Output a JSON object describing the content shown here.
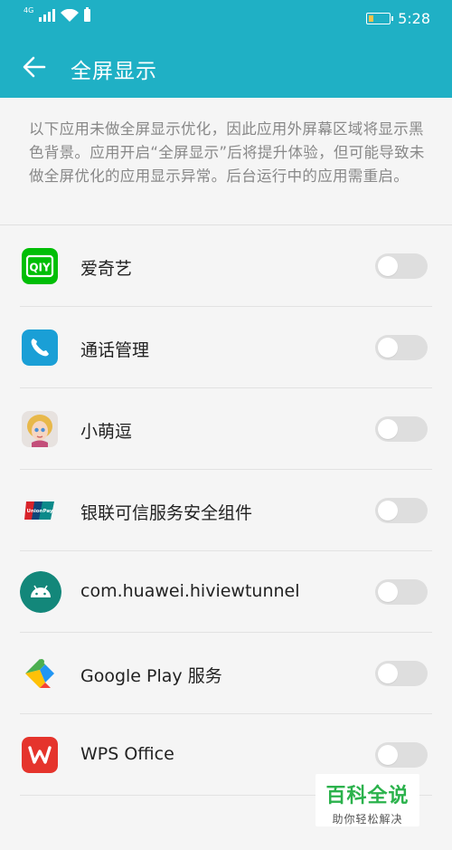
{
  "status_bar": {
    "network_label": "4G",
    "time": "5:28",
    "battery_color": "#f3c24a"
  },
  "header": {
    "title": "全屏显示",
    "back_icon": "arrow-left-icon",
    "background": "#1fb0c5"
  },
  "description": "以下应用未做全屏显示优化，因此应用外屏幕区域将显示黑色背景。应用开启“全屏显示”后将提升体验，但可能导致未做全屏优化的应用显示异常。后台运行中的应用需重启。",
  "apps": [
    {
      "name": "爱奇艺",
      "icon": "iqiyi-icon",
      "enabled": false
    },
    {
      "name": "通话管理",
      "icon": "phone-icon",
      "enabled": false
    },
    {
      "name": "小萌逗",
      "icon": "avatar-icon",
      "enabled": false
    },
    {
      "name": "银联可信服务安全组件",
      "icon": "unionpay-icon",
      "enabled": false
    },
    {
      "name": "com.huawei.hiviewtunnel",
      "icon": "android-icon",
      "enabled": false
    },
    {
      "name": "Google Play 服务",
      "icon": "puzzle-icon",
      "enabled": false
    },
    {
      "name": "WPS Office",
      "icon": "wps-icon",
      "enabled": false
    }
  ],
  "watermark": {
    "title": "百科全说",
    "subtitle": "助你轻松解决",
    "color": "#2bb24c"
  }
}
